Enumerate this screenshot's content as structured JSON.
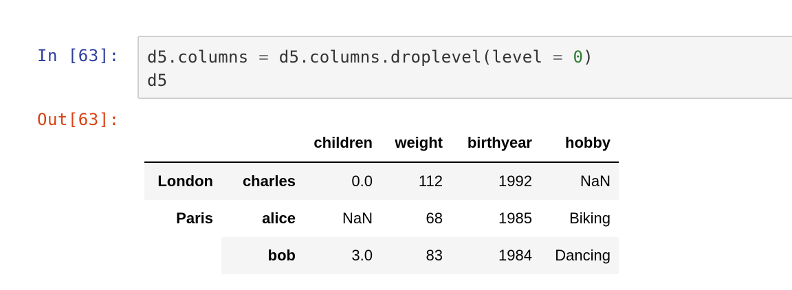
{
  "cell": {
    "in_prompt": "In [63]:",
    "out_prompt": "Out[63]:",
    "code": {
      "line1_a": "d5.columns ",
      "line1_eq": "=",
      "line1_b": " d5.columns.droplevel(level ",
      "line1_eq2": "=",
      "line1_sp": " ",
      "line1_num": "0",
      "line1_close": ")",
      "line2": "d5"
    }
  },
  "dataframe": {
    "columns": [
      "children",
      "weight",
      "birthyear",
      "hobby"
    ],
    "rows": [
      {
        "level0": "London",
        "level1": "charles",
        "children": "0.0",
        "weight": "112",
        "birthyear": "1992",
        "hobby": "NaN"
      },
      {
        "level0": "Paris",
        "level1": "alice",
        "children": "NaN",
        "weight": "68",
        "birthyear": "1985",
        "hobby": "Biking"
      },
      {
        "level0": "",
        "level1": "bob",
        "children": "3.0",
        "weight": "83",
        "birthyear": "1984",
        "hobby": "Dancing"
      }
    ]
  },
  "colors": {
    "in_prompt": "#303f9f",
    "out_prompt": "#d84315",
    "cell_bg": "#f5f5f5",
    "cell_border": "#cfcfcf",
    "row_shade": "#f5f5f5"
  }
}
